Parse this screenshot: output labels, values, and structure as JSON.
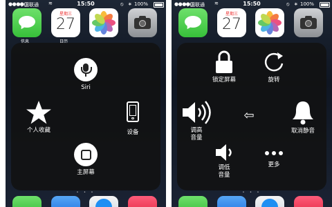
{
  "status_bar": {
    "signal": "●●●●○",
    "carrier": "中国联通",
    "wifi": "≋",
    "time": "15:50",
    "rotation_lock": "⦸",
    "bluetooth": "∗",
    "battery_text": "100%"
  },
  "home_screen": {
    "apps": [
      {
        "icon": "messages-icon",
        "label": "信息"
      },
      {
        "icon": "calendar-icon",
        "label": "日历",
        "dow": "星期三",
        "day": "27"
      },
      {
        "icon": "photos-icon",
        "label": "照片"
      },
      {
        "icon": "camera-icon",
        "label": "相机"
      }
    ],
    "dock": [
      "phone-icon",
      "mail-icon",
      "safari-icon",
      "music-icon"
    ],
    "page_dots": "• • •"
  },
  "left_menu": {
    "siri": "Siri",
    "favorites": "个人收藏",
    "device": "设备",
    "home": "主屏幕"
  },
  "right_menu": {
    "lock_screen": "锁定屏幕",
    "rotate": "旋转",
    "volume_up": "调高\n音量",
    "back": "⇦",
    "mute": "取消静音",
    "volume_down": "调低\n音量",
    "more": "更多"
  },
  "colors": {
    "overlay": "#121212",
    "icon": "#ffffff",
    "wallpaper": "#151d2a",
    "messages": "#37c03a"
  }
}
